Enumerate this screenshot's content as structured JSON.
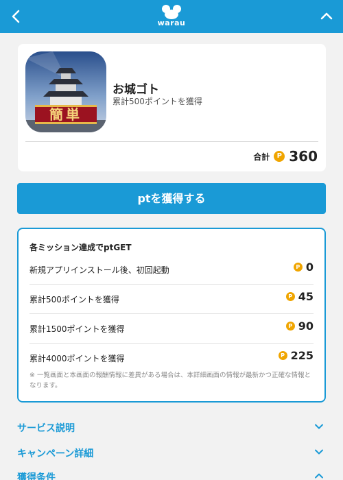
{
  "header": {
    "logo_text": "warau",
    "back_icon": "chevron-left-icon",
    "collapse_icon": "chevron-up-icon",
    "bar_color": "#1a9ad6"
  },
  "app": {
    "name": "お城ゴト",
    "subtitle": "累計500ポイントを獲得",
    "icon": "castle-app-icon",
    "icon_badge_text": "簡単",
    "total_label": "合計",
    "coin_symbol": "P",
    "total_points": "360"
  },
  "cta": {
    "label": "ptを獲得する"
  },
  "missions": {
    "title": "各ミッション達成でptGET",
    "items": [
      {
        "label": "新規アプリインストール後、初回起動",
        "points": "0"
      },
      {
        "label": "累計500ポイントを獲得",
        "points": "45"
      },
      {
        "label": "累計1500ポイントを獲得",
        "points": "90"
      },
      {
        "label": "累計4000ポイントを獲得",
        "points": "225"
      }
    ],
    "note": "※ 一覧画面と本画面の報酬情報に差異がある場合は、本詳細画面の情報が最新かつ正確な情報となります。"
  },
  "sections": [
    {
      "label": "サービス説明",
      "icon": "chevron-down-icon"
    },
    {
      "label": "キャンペーン詳細",
      "icon": "chevron-down-icon"
    },
    {
      "label": "獲得条件",
      "icon": "chevron-up-icon"
    }
  ],
  "colors": {
    "accent": "#1a9ad6",
    "coin": "#f0a500"
  }
}
